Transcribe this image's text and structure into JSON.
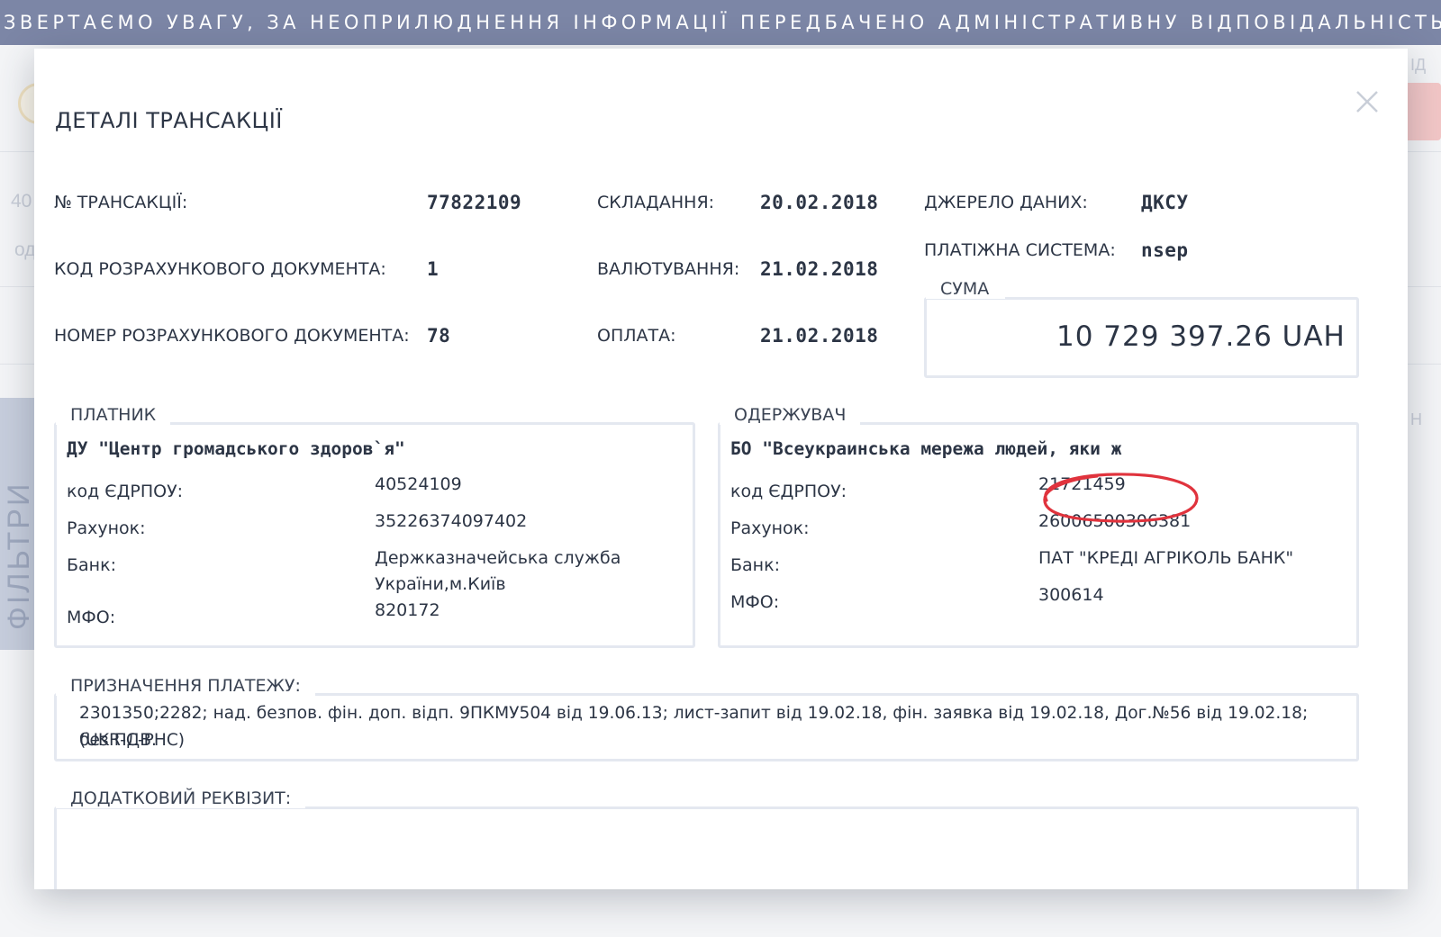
{
  "banner": {
    "text": "ЗВЕРТАЄМО УВАГУ, ЗА НЕОПРИЛЮДНЕННЯ ІНФОРМАЦІЇ ПЕРЕДБАЧЕНО АДМІНІСТРАТИВНУ ВІДПОВІДАЛЬНІСТЬ"
  },
  "background": {
    "left_number": "40",
    "left_text": "од",
    "right_hint": "ІД",
    "right_char": "Н",
    "filter_label": "ФІЛЬТРИ"
  },
  "modal": {
    "title": "ДЕТАЛІ ТРАНСАКЦІЇ",
    "close_icon": "close-icon",
    "fields": {
      "transaction_no_label": "№ ТРАНСАКЦІЇ:",
      "transaction_no": "77822109",
      "doc_code_label": "КОД РОЗРАХУНКОВОГО ДОКУМЕНТА:",
      "doc_code": "1",
      "doc_number_label": "НОМЕР РОЗРАХУНКОВОГО ДОКУМЕНТА:",
      "doc_number": "78",
      "compiled_label": "СКЛАДАННЯ:",
      "compiled": "20.02.2018",
      "value_date_label": "ВАЛЮТУВАННЯ:",
      "value_date": "21.02.2018",
      "payment_label": "ОПЛАТА:",
      "payment": "21.02.2018",
      "source_label": "ДЖЕРЕЛО ДАНИХ:",
      "source": "ДКСУ",
      "system_label": "ПЛАТІЖНА СИСТЕМА:",
      "system": "nsep"
    },
    "sum": {
      "legend": "СУМА",
      "amount": "10 729 397.26 UAH"
    },
    "payer": {
      "legend": "ПЛАТНИК",
      "name": "ДУ \"Центр громадського здоров`я\"",
      "edrpou_label": "код ЄДРПОУ:",
      "edrpou": "40524109",
      "account_label": "Рахунок:",
      "account": "35226374097402",
      "bank_label": "Банк:",
      "bank_line1": "Держказначейська служба",
      "bank_line2": "України,м.Київ",
      "mfo_label": "МФО:",
      "mfo": "820172"
    },
    "receiver": {
      "legend": "ОДЕРЖУВАЧ",
      "name": "БО \"Всеукраинська мережа людей, яки ж",
      "edrpou_label": "код ЄДРПОУ:",
      "edrpou": "21721459",
      "account_label": "Рахунок:",
      "account": "26006500306381",
      "bank_label": "Банк:",
      "bank": "ПАТ \"КРЕДІ АГРІКОЛЬ БАНК\"",
      "mfo_label": "МФО:",
      "mfo": "300614"
    },
    "purpose": {
      "legend": "ПРИЗНАЧЕННЯ ПЛАТЕЖУ:",
      "line1": "2301350;2282; над. безпов. фін. доп. відп. 9ПКМУ504 від 19.06.13; лист-запит від 19.02.18, фін. заявка від 19.02.18, Дог.№56 від 19.02.18; (UKR-C-PHC)",
      "line2": "без ПДВ."
    },
    "extra": {
      "legend": "ДОДАТКОВИЙ РЕКВІЗИТ:",
      "value": ""
    }
  },
  "colors": {
    "banner": "#7c86a6",
    "annotation": "#e0333d",
    "border": "#e4e8f0",
    "text": "#2c3545"
  }
}
